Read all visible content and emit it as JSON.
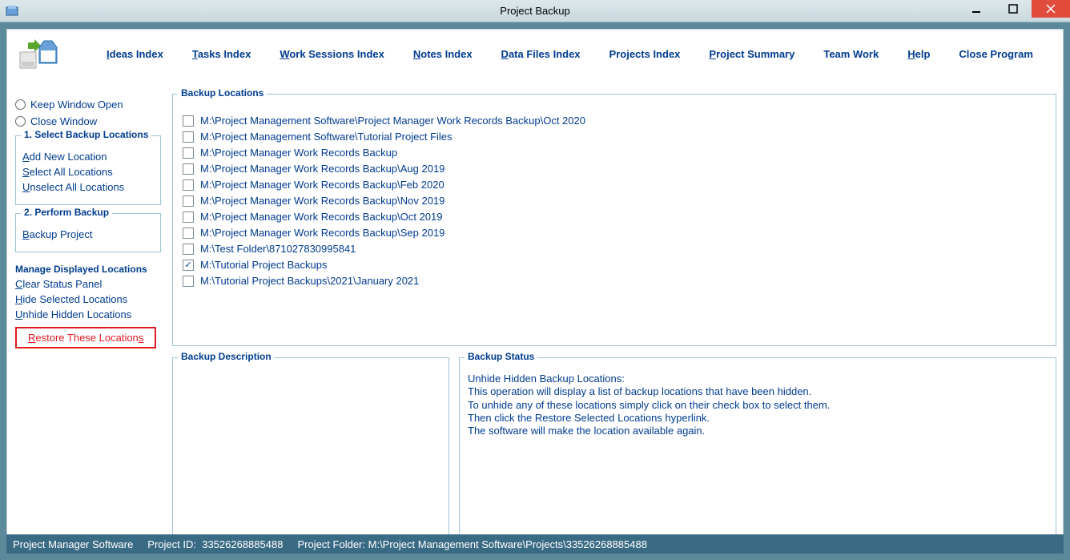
{
  "title": "Project Backup",
  "menu": {
    "ideas": "Ideas Index",
    "tasks": "Tasks Index",
    "work_sessions": "Work Sessions Index",
    "notes": "Notes Index",
    "data_files": "Data Files Index",
    "projects": "Projects Index",
    "project_summary": "Project Summary",
    "team_work": "Team Work",
    "help": "Help",
    "close_program": "Close Program"
  },
  "sidebar": {
    "keep_open": "Keep Window Open",
    "close_window": "Close Window",
    "group1_title": "1. Select Backup Locations",
    "add_new": "Add New Location",
    "select_all": "Select All Locations",
    "unselect_all": "Unselect All Locations",
    "group2_title": "2. Perform Backup",
    "backup_project": "Backup Project",
    "manage_label": "Manage Displayed Locations",
    "clear_status": "Clear Status Panel",
    "hide_selected": "Hide Selected Locations",
    "unhide_hidden": "Unhide Hidden Locations",
    "restore_these": "Restore These Locations"
  },
  "locations": {
    "title": "Backup Locations",
    "items": [
      {
        "label": "M:\\Project Management Software\\Project Manager Work Records Backup\\Oct 2020",
        "checked": false
      },
      {
        "label": "M:\\Project Management Software\\Tutorial Project Files",
        "checked": false
      },
      {
        "label": "M:\\Project Manager Work Records Backup",
        "checked": false
      },
      {
        "label": "M:\\Project Manager Work Records Backup\\Aug 2019",
        "checked": false
      },
      {
        "label": "M:\\Project Manager Work Records Backup\\Feb 2020",
        "checked": false
      },
      {
        "label": "M:\\Project Manager Work Records Backup\\Nov 2019",
        "checked": false
      },
      {
        "label": "M:\\Project Manager Work Records Backup\\Oct 2019",
        "checked": false
      },
      {
        "label": "M:\\Project Manager Work Records Backup\\Sep 2019",
        "checked": false
      },
      {
        "label": "M:\\Test Folder\\871027830995841",
        "checked": false
      },
      {
        "label": "M:\\Tutorial Project Backups",
        "checked": true
      },
      {
        "label": "M:\\Tutorial Project Backups\\2021\\January 2021",
        "checked": false
      }
    ]
  },
  "backup_description_title": "Backup Description",
  "backup_status": {
    "title": "Backup Status",
    "lines": [
      "Unhide Hidden Backup Locations:",
      "This operation will display a list of backup locations that have been hidden.",
      "To unhide any of these locations simply click on their check box to select them.",
      "Then click the Restore Selected Locations hyperlink.",
      "The software will make the location available again."
    ]
  },
  "statusbar": {
    "app": "Project Manager Software",
    "project_id_label": "Project ID:",
    "project_id": "33526268885488",
    "project_folder_label": "Project Folder:",
    "project_folder": "M:\\Project Management Software\\Projects\\33526268885488"
  }
}
